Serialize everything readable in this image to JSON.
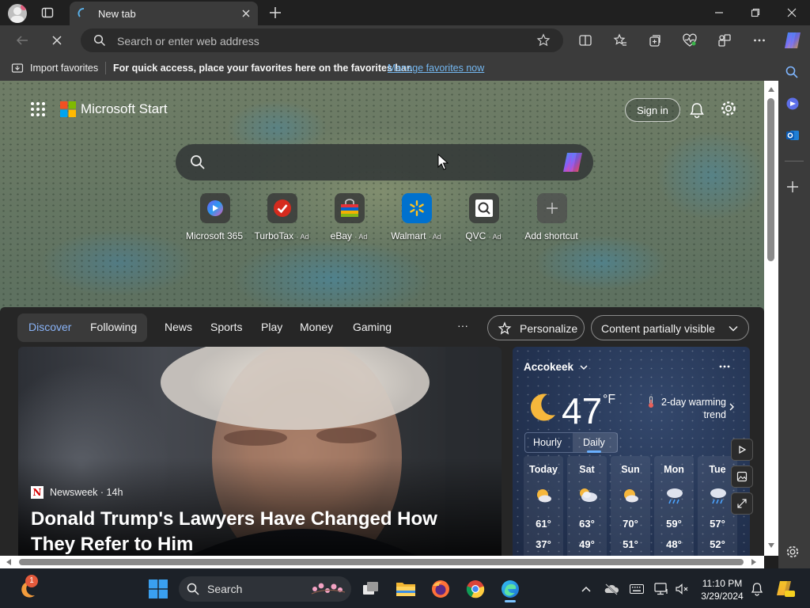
{
  "browser": {
    "tab_title": "New tab",
    "address_placeholder": "Search or enter web address"
  },
  "favorites_bar": {
    "import_label": "Import favorites",
    "message": "For quick access, place your favorites here on the favorites bar.",
    "manage_link": "Manage favorites now"
  },
  "page": {
    "brand": "Microsoft Start",
    "sign_in": "Sign in",
    "shortcuts": [
      {
        "label": "Microsoft 365",
        "ad": ""
      },
      {
        "label": "TurboTax",
        "ad": "· Ad"
      },
      {
        "label": "eBay",
        "ad": "· Ad"
      },
      {
        "label": "Walmart",
        "ad": "· Ad"
      },
      {
        "label": "QVC",
        "ad": "· Ad"
      },
      {
        "label": "Add shortcut",
        "ad": ""
      }
    ]
  },
  "feed": {
    "tabs": [
      "Discover",
      "Following",
      "News",
      "Sports",
      "Play",
      "Money",
      "Gaming"
    ],
    "more": "···",
    "personalize": "Personalize",
    "content_visibility": "Content partially visible",
    "hero": {
      "source": "Newsweek · 14h",
      "source_logo": "N",
      "headline": "Donald Trump's Lawyers Have Changed How They Refer to Him"
    }
  },
  "weather": {
    "location": "Accokeek",
    "temperature": "47",
    "unit": "°F",
    "trend": "2-day warming trend",
    "tabs": [
      "Hourly",
      "Daily"
    ],
    "forecast": [
      {
        "day": "Today",
        "high": "61°",
        "low": "37°",
        "icon": "partly-sunny-icon"
      },
      {
        "day": "Sat",
        "high": "63°",
        "low": "49°",
        "icon": "cloudy-sun-icon"
      },
      {
        "day": "Sun",
        "high": "70°",
        "low": "51°",
        "icon": "partly-sunny-icon"
      },
      {
        "day": "Mon",
        "high": "59°",
        "low": "48°",
        "icon": "rain-icon"
      },
      {
        "day": "Tue",
        "high": "57°",
        "low": "52°",
        "icon": "rain-icon"
      }
    ]
  },
  "taskbar": {
    "search_label": "Search",
    "time": "11:10 PM",
    "date": "3/29/2024",
    "notification_badge": "1"
  }
}
